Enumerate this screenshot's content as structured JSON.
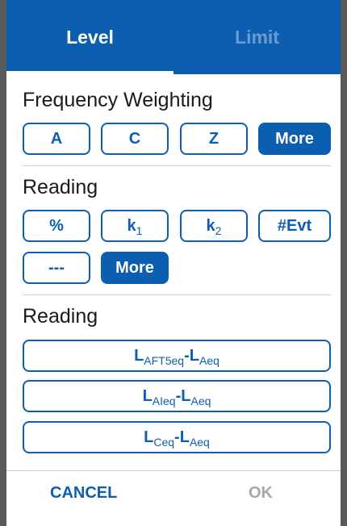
{
  "tabs": [
    {
      "label": "Level",
      "active": true
    },
    {
      "label": "Limit",
      "active": false
    }
  ],
  "sections": {
    "weighting": {
      "title": "Frequency Weighting",
      "options": [
        {
          "label": "A"
        },
        {
          "label": "C"
        },
        {
          "label": "Z"
        },
        {
          "label": "More"
        }
      ]
    },
    "reading1": {
      "title": "Reading",
      "options": [
        {
          "label": "%"
        },
        {
          "main": "k",
          "sub": "1"
        },
        {
          "main": "k",
          "sub": "2"
        },
        {
          "label": "#Evt"
        },
        {
          "label": "---"
        },
        {
          "label": "More"
        }
      ]
    },
    "reading2": {
      "title": "Reading",
      "options": [
        {
          "l1": "L",
          "s1": "AFT5eq",
          "dash": "-",
          "l2": "L",
          "s2": "Aeq"
        },
        {
          "l1": "L",
          "s1": "AIeq",
          "dash": "-",
          "l2": "L",
          "s2": "Aeq"
        },
        {
          "l1": "L",
          "s1": "Ceq",
          "dash": "-",
          "l2": "L",
          "s2": "Aeq"
        }
      ]
    }
  },
  "footer": {
    "cancel_label": "CANCEL",
    "ok_label": "OK"
  },
  "colors": {
    "accent": "#0c5fb0",
    "tab_inactive": "#6b9bd0",
    "disabled": "#a8a8a8"
  }
}
